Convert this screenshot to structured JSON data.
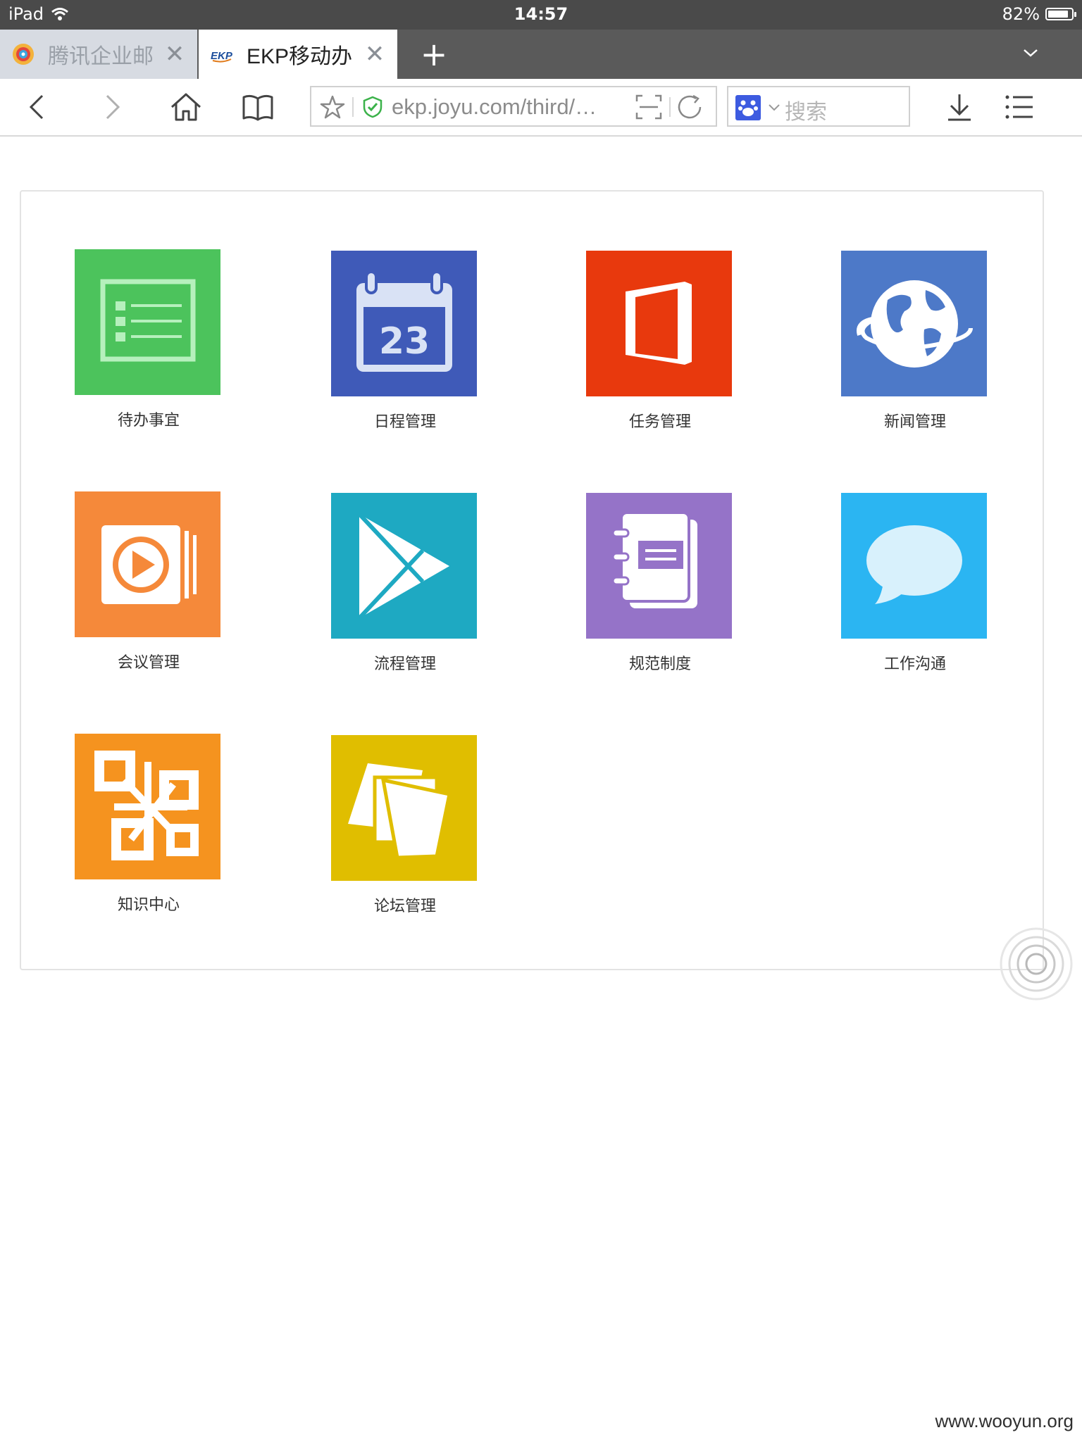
{
  "status_bar": {
    "device": "iPad",
    "time": "14:57",
    "battery": "82%"
  },
  "tabs": [
    {
      "title": "腾讯企业邮",
      "active": false
    },
    {
      "title": "EKP移动办",
      "active": true
    }
  ],
  "toolbar": {
    "url": "ekp.joyu.com/third/…",
    "search_placeholder": "搜索"
  },
  "apps": [
    {
      "label": "待办事宜",
      "color": "#4cc35c",
      "icon": "list-icon"
    },
    {
      "label": "日程管理",
      "color": "#3f5ab8",
      "icon": "calendar-icon",
      "calendar_day": "23"
    },
    {
      "label": "任务管理",
      "color": "#e8390d",
      "icon": "office-icon"
    },
    {
      "label": "新闻管理",
      "color": "#4d79c8",
      "icon": "globe-icon"
    },
    {
      "label": "会议管理",
      "color": "#f5893a",
      "icon": "video-icon"
    },
    {
      "label": "流程管理",
      "color": "#1ea9c2",
      "icon": "play-icon"
    },
    {
      "label": "规范制度",
      "color": "#9573c8",
      "icon": "notebook-icon"
    },
    {
      "label": "工作沟通",
      "color": "#2bb5f2",
      "icon": "speech-bubble-icon"
    },
    {
      "label": "知识中心",
      "color": "#f5931f",
      "icon": "network-icon"
    },
    {
      "label": "论坛管理",
      "color": "#e0be00",
      "icon": "notes-icon"
    }
  ],
  "watermark": "www.wooyun.org"
}
